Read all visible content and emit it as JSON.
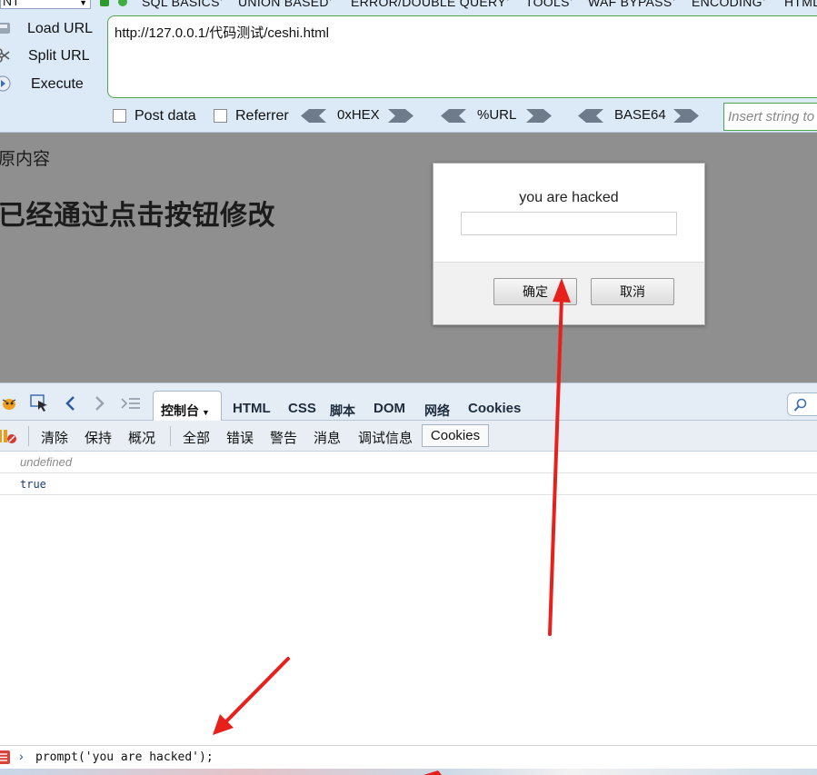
{
  "hackbar": {
    "select_value": "NT",
    "menus": [
      "SQL BASICS",
      "UNION BASED",
      "ERROR/DOUBLE QUERY",
      "TOOLS",
      "WAF BYPASS",
      "ENCODING",
      "HTML"
    ],
    "actions": {
      "load": "Load URL",
      "split": "Split URL",
      "execute": "Execute"
    },
    "url": "http://127.0.0.1/代码测试/ceshi.html",
    "checks": {
      "post": "Post data",
      "referrer": "Referrer"
    },
    "encoders": {
      "hex": "0xHEX",
      "url": "%URL",
      "base64": "BASE64"
    },
    "insert_placeholder": "Insert string to"
  },
  "page": {
    "original_text": "原内容",
    "heading": "已经通过点击按钮修改"
  },
  "dialog": {
    "message": "you are hacked",
    "input_value": "",
    "ok_label": "确定",
    "cancel_label": "取消"
  },
  "firebug": {
    "tabs": {
      "console": "控制台",
      "html": "HTML",
      "css": "CSS",
      "script": "脚本",
      "dom": "DOM",
      "net": "网络",
      "cookies": "Cookies"
    },
    "filters": {
      "clear": "清除",
      "persist": "保持",
      "profile": "概况",
      "all": "全部",
      "errors": "错误",
      "warnings": "警告",
      "info": "消息",
      "debug": "调试信息",
      "cookies": "Cookies"
    },
    "log": [
      "undefined",
      "true"
    ],
    "command_prompt": "›",
    "command": "prompt('you are hacked');"
  },
  "colors": {
    "hackbar_bg": "#dce9f7",
    "overlay": "#8f8f8f",
    "annotation_arrow": "#e8201c",
    "url_border": "#4ea84e"
  }
}
